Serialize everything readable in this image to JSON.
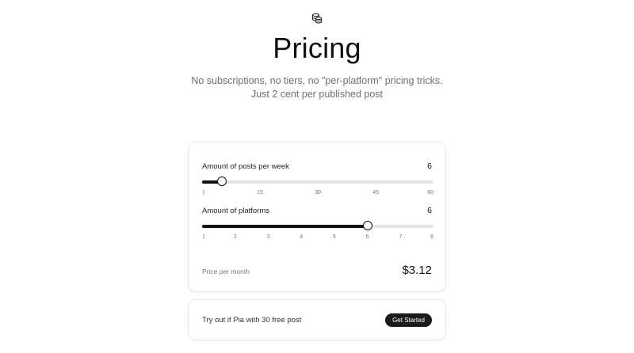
{
  "header": {
    "logo_icon": "stacked-coins-icon",
    "title": "Pricing",
    "subtitle_line1": "No subscriptions, no tiers, no \"per-platform\" pricing tricks.",
    "subtitle_line2": "Just 2 cent per published post"
  },
  "calculator": {
    "posts": {
      "label": "Amount of posts per week",
      "value": "6",
      "min": 1,
      "max": 60,
      "current": 6,
      "ticks": [
        "1",
        "15",
        "30",
        "45",
        "60"
      ]
    },
    "platforms": {
      "label": "Amount of platforms",
      "value": "6",
      "min": 1,
      "max": 8,
      "current": 6,
      "ticks": [
        "1",
        "2",
        "3",
        "4",
        "5",
        "6",
        "7",
        "8"
      ]
    },
    "price_label": "Price per month",
    "price_value": "$3.12"
  },
  "cta": {
    "text": "Try out if Pia with 30 free post",
    "button_label": "Get Started"
  },
  "colors": {
    "accent": "#111111",
    "track": "#e4e4e4",
    "button_bg": "#1b1b1b"
  }
}
